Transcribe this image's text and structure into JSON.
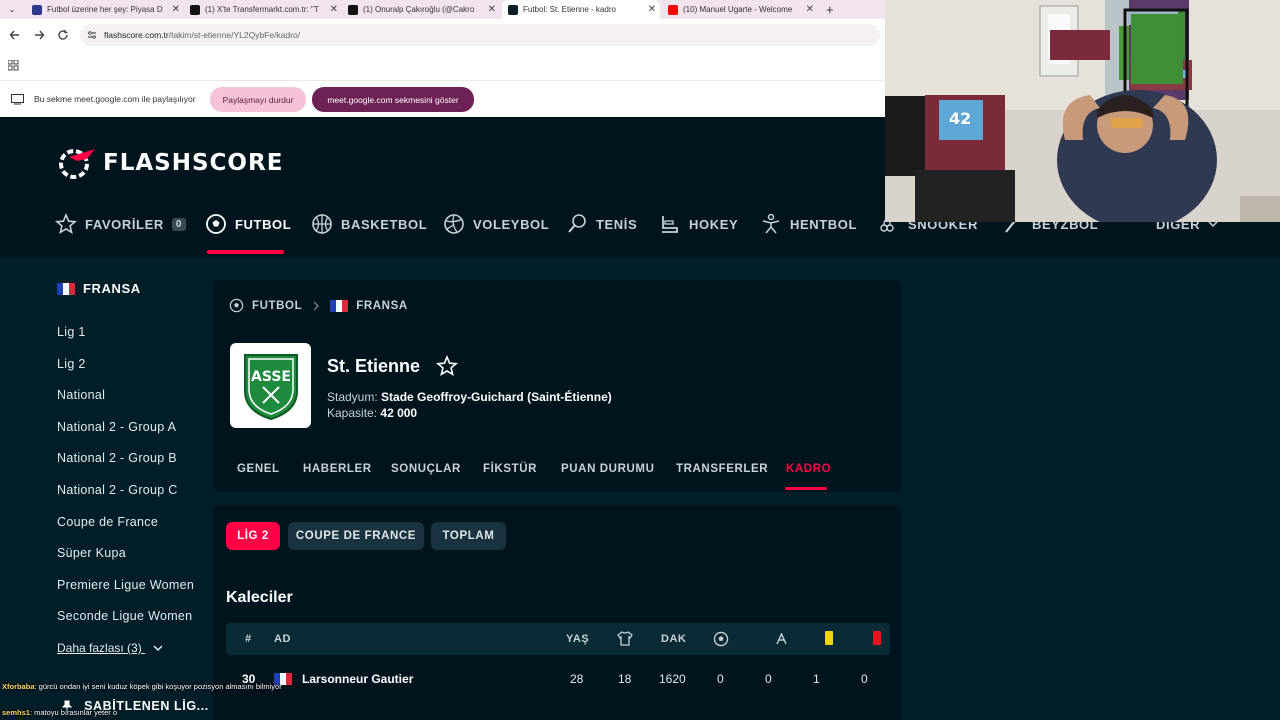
{
  "browser": {
    "tabs": [
      {
        "title": "Futbol üzerine her şey: Piyasa D",
        "color": "#2d3a8c"
      },
      {
        "title": "(1) X'te Transfermarkt.com.tr: \"T",
        "color": "#111111"
      },
      {
        "title": "(1) Onuralp Çakıroğlu (@Cakro",
        "color": "#111111"
      },
      {
        "title": "Futbol: St. Etienne - kadro",
        "color": "#0a1e28"
      },
      {
        "title": "(10) Manuel Ugarte - Welcome",
        "color": "#ff0000"
      }
    ],
    "new_tab": "+",
    "url_host": "flashscore.com.tr",
    "url_path": "/takim/st-etienne/YL2QybFe/kadro/",
    "share_message": "Bu sekme meet.google.com ile paylaşılıyor",
    "stop_sharing": "Paylaşmayı durdur",
    "show_tab": "meet.google.com sekmesini göster"
  },
  "site": {
    "logo_text": "FLASHSCORE",
    "sports": [
      {
        "label": "FAVORİLER",
        "icon": "star-icon"
      },
      {
        "label": "FUTBOL",
        "icon": "soccer-ball-icon"
      },
      {
        "label": "BASKETBOL",
        "icon": "basketball-icon"
      },
      {
        "label": "VOLEYBOL",
        "icon": "volleyball-icon"
      },
      {
        "label": "TENİS",
        "icon": "tennis-icon"
      },
      {
        "label": "HOKEY",
        "icon": "hockey-icon"
      },
      {
        "label": "HENTBOL",
        "icon": "handball-icon"
      },
      {
        "label": "SNOOKER",
        "icon": "snooker-icon"
      },
      {
        "label": "BEYZBOL",
        "icon": "baseball-icon"
      },
      {
        "label": "DİĞER",
        "icon": "chevron-down-icon"
      }
    ],
    "favorites_count": "0",
    "accent": "#ff0046"
  },
  "sidebar": {
    "country": "FRANSA",
    "leagues": [
      "Lig 1",
      "Lig 2",
      "National",
      "National 2 - Group A",
      "National 2 - Group B",
      "National 2 - Group C",
      "Coupe de France",
      "Süper Kupa",
      "Premiere Ligue Women",
      "Seconde Ligue Women"
    ],
    "more": "Daha fazlası (3)",
    "pinned": "SABİTLENEN LİG..."
  },
  "team": {
    "breadcrumb": [
      "FUTBOL",
      "FRANSA"
    ],
    "name": "St. Etienne",
    "stadium_label": "Stadyum:",
    "stadium": "Stade Geoffroy-Guichard (Saint-Étienne)",
    "capacity_label": "Kapasite:",
    "capacity": "42 000",
    "logo_text": "ASSE",
    "tabs": [
      "GENEL",
      "HABERLER",
      "SONUÇLAR",
      "FİKSTÜR",
      "PUAN DURUMU",
      "TRANSFERLER",
      "KADRO"
    ]
  },
  "squad": {
    "filters": [
      "LİG 2",
      "COUPE DE FRANCE",
      "TOPLAM"
    ],
    "section": "Kaleciler",
    "headers": {
      "num": "#",
      "name": "AD",
      "age": "YAŞ",
      "min": "DAK"
    },
    "rows": [
      {
        "num": "30",
        "name": "Larsonneur Gautier",
        "age": "28",
        "apps": "18",
        "min": "1620",
        "goals": "0",
        "assists": "0",
        "yellow": "1",
        "red": "0"
      }
    ]
  },
  "chat": [
    {
      "user": "Xforbaba",
      "msg": ": gürcü ondan iyi seni kuduz köpek gibi koşuyor pozisyon almasını bilmiyor"
    },
    {
      "user": "semhs1",
      "msg": ": matoyu bırasınlar yeter o"
    }
  ]
}
